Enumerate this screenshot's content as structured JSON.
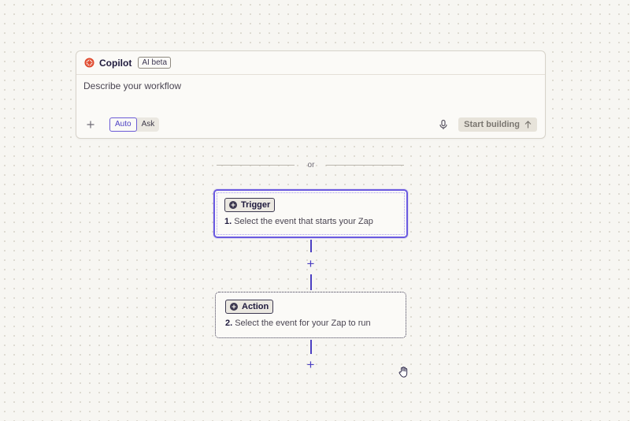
{
  "copilot": {
    "title": "Copilot",
    "badge": "AI beta",
    "prompt_placeholder": "Describe your workflow",
    "add_icon": "plus-icon",
    "mode_options": [
      "Auto",
      "Ask"
    ],
    "mode_selected": "Auto",
    "mic_icon": "microphone-icon",
    "start_label": "Start building",
    "start_icon": "arrow-up-icon"
  },
  "separator": {
    "text": "or"
  },
  "steps": [
    {
      "badge": "Trigger",
      "number": "1.",
      "description": "Select the event that starts your Zap",
      "selected": true
    },
    {
      "badge": "Action",
      "number": "2.",
      "description": "Select the event for your Zap to run",
      "selected": false
    }
  ],
  "add_step_symbol": "+",
  "colors": {
    "accent": "#6a5ae0",
    "accent_dark": "#4b3fc2",
    "background": "#f7f6f2",
    "card": "#fbfaf7",
    "logo_red": "#e04a2f"
  }
}
